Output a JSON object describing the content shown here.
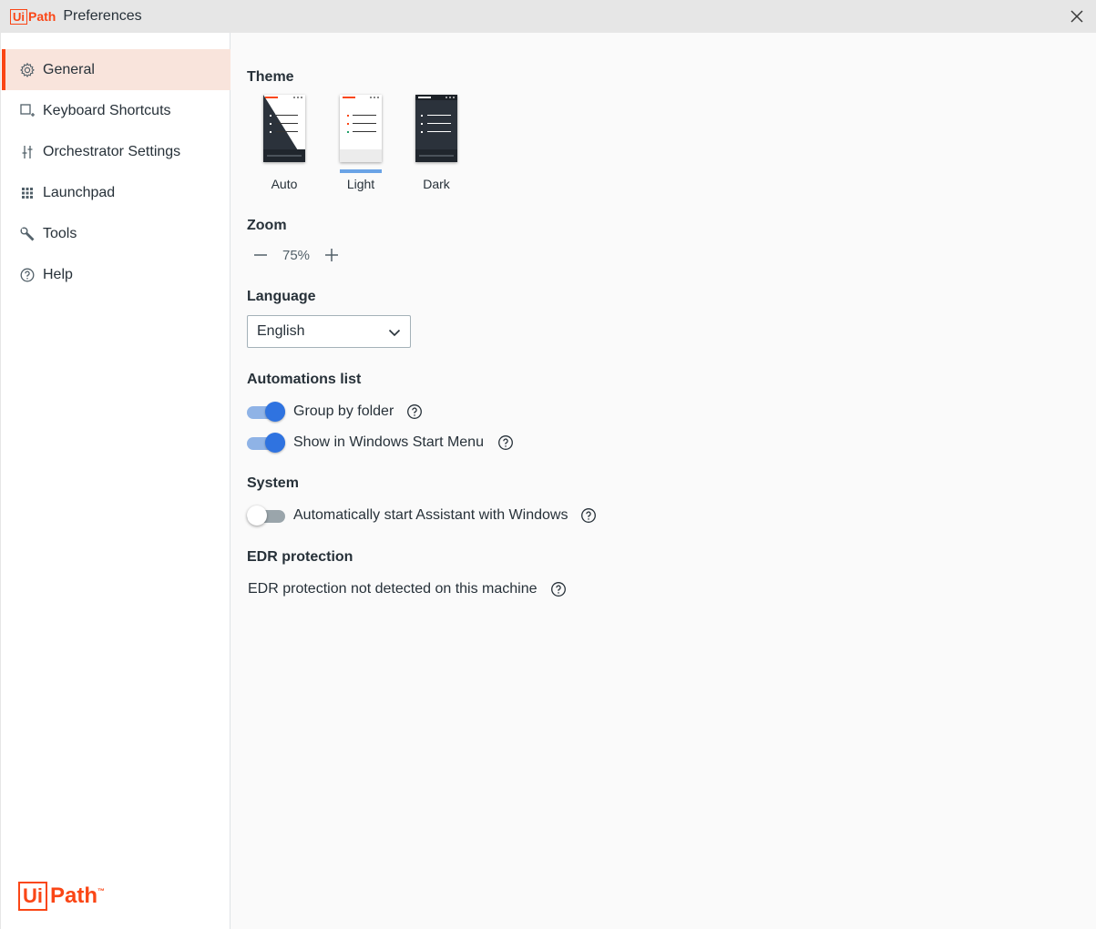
{
  "window": {
    "logo_ui": "Ui",
    "logo_path": "Path",
    "title": "Preferences",
    "close_icon": "close-icon"
  },
  "sidebar": {
    "items": [
      {
        "label": "General",
        "icon": "gear-icon",
        "active": true
      },
      {
        "label": "Keyboard Shortcuts",
        "icon": "keyboard-shortcut-icon",
        "active": false
      },
      {
        "label": "Orchestrator Settings",
        "icon": "sliders-icon",
        "active": false
      },
      {
        "label": "Launchpad",
        "icon": "grid-icon",
        "active": false
      },
      {
        "label": "Tools",
        "icon": "wrench-icon",
        "active": false
      },
      {
        "label": "Help",
        "icon": "help-circle-icon",
        "active": false
      }
    ],
    "logo_ui": "Ui",
    "logo_path": "Path",
    "logo_tm": "™"
  },
  "theme": {
    "title": "Theme",
    "options": [
      {
        "label": "Auto",
        "selected": false
      },
      {
        "label": "Light",
        "selected": true
      },
      {
        "label": "Dark",
        "selected": false
      }
    ]
  },
  "zoom": {
    "title": "Zoom",
    "value": "75%"
  },
  "language": {
    "title": "Language",
    "selected": "English"
  },
  "automations": {
    "title": "Automations list",
    "toggles": [
      {
        "label": "Group by folder",
        "on": true
      },
      {
        "label": "Show in Windows Start Menu",
        "on": true
      }
    ]
  },
  "system": {
    "title": "System",
    "toggles": [
      {
        "label": "Automatically start Assistant with Windows",
        "on": false
      }
    ]
  },
  "edr": {
    "title": "EDR protection",
    "status": "EDR protection not detected on this machine"
  },
  "colors": {
    "brand": "#fa4616",
    "toggle_on": "#2f73e0",
    "active_bg": "#f9e4dc"
  }
}
